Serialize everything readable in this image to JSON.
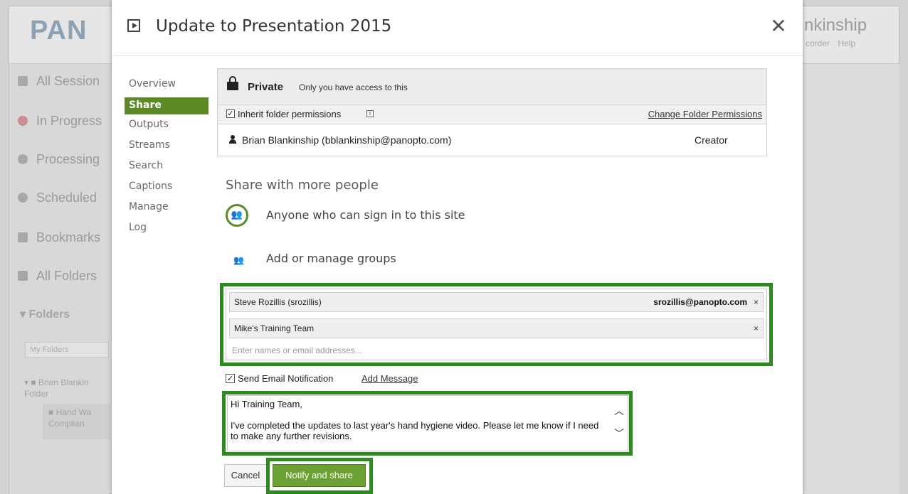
{
  "background": {
    "logo": "PAN",
    "user_name": "nkinship",
    "sublinks": [
      "corder",
      "Help"
    ],
    "nav_items": [
      "All Session",
      "In Progress",
      "Processing",
      "Scheduled",
      "Bookmarks",
      "All Folders"
    ],
    "folders_heading": "Folders",
    "folders_search_placeholder": "My Folders",
    "tree_items": [
      "Brian Blankin Folder",
      "Hand Wa Complian"
    ]
  },
  "dialog": {
    "title": "Update to Presentation 2015",
    "close_glyph": "✕",
    "tabs": [
      {
        "label": "Overview"
      },
      {
        "label": "Share"
      },
      {
        "label": "Outputs"
      },
      {
        "label": "Streams"
      },
      {
        "label": "Search"
      },
      {
        "label": "Captions"
      },
      {
        "label": "Manage"
      },
      {
        "label": "Log"
      }
    ],
    "active_tab": "Share"
  },
  "permissions": {
    "private_label": "Private",
    "private_description": "Only you have access to this",
    "inherit_checked": true,
    "inherit_label": "Inherit folder permissions",
    "change_link": "Change Folder Permissions",
    "owner": {
      "name": "Brian Blankinship (bblankinship@panopto.com)",
      "role": "Creator"
    }
  },
  "share": {
    "heading": "Share with more people",
    "anyone_label": "Anyone who can sign in to this site",
    "groups_label": "Add or manage groups",
    "recipients": [
      {
        "name": "Steve Rozillis (srozillis)",
        "email": "srozillis@panopto.com",
        "remove": "×"
      },
      {
        "name": "Mike's Training Team",
        "email": "",
        "remove": "×"
      }
    ],
    "recipient_placeholder": "Enter names or email addresses...",
    "notify_checked": true,
    "notify_label": "Send Email Notification",
    "add_message_link": "Add Message",
    "message": "Hi Training Team,\n\nI've completed the updates to last year's hand hygiene video. Please let me know if I need to make any further revisions.",
    "cancel_label": "Cancel",
    "submit_label": "Notify and share"
  },
  "colors": {
    "accent_green": "#5c8a25",
    "highlight_green": "#2d8a1f",
    "button_green": "#6ba032"
  }
}
